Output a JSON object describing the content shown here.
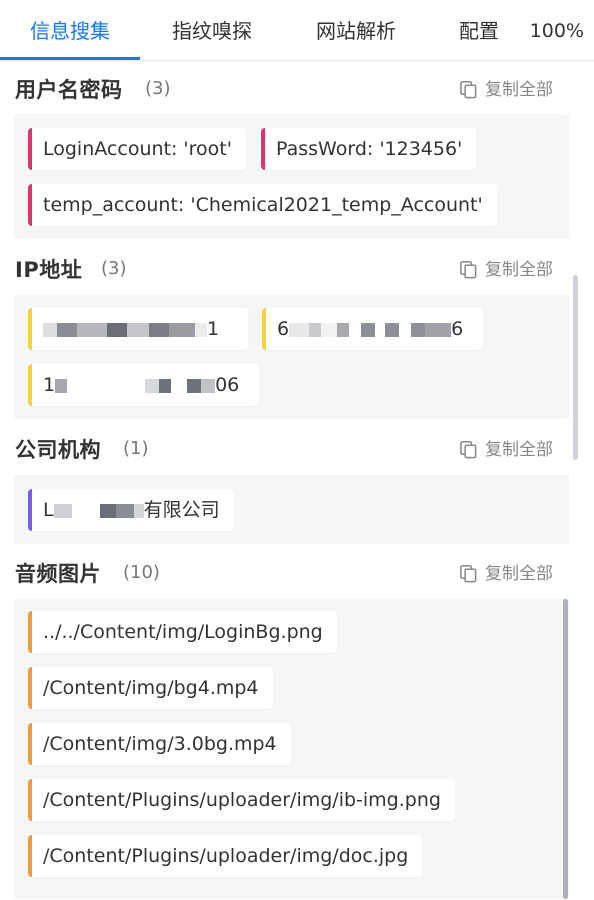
{
  "tabs": [
    {
      "label": "信息搜集",
      "active": true
    },
    {
      "label": "指纹嗅探",
      "active": false
    },
    {
      "label": "网站解析",
      "active": false
    },
    {
      "label": "配置",
      "active": false
    }
  ],
  "zoom": "100%",
  "copy_all_label": "复制全部",
  "accent_color": "#1677ff",
  "sections": {
    "credentials": {
      "title": "用户名密码",
      "count": "(3)",
      "color": "#d9366f",
      "items": [
        "LoginAccount: 'root'",
        "PassWord: '123456'",
        "temp_account: 'Chemical2021_temp_Account'"
      ]
    },
    "ip": {
      "title": "IP地址",
      "count": "(3)",
      "color": "#f5d042",
      "items": [
        "1",
        "6",
        "6",
        "1",
        "06"
      ]
    },
    "org": {
      "title": "公司机构",
      "count": "(1)",
      "color": "#7b5cf0",
      "items": [
        "L",
        "有限公司"
      ]
    },
    "media": {
      "title": "音频图片",
      "count": "(10)",
      "color": "#f49b3a",
      "items": [
        "../../Content/img/LoginBg.png",
        "/Content/img/bg4.mp4",
        "/Content/img/3.0bg.mp4",
        "/Content/Plugins/uploader/img/ib-img.png",
        "/Content/Plugins/uploader/img/doc.jpg"
      ]
    }
  }
}
